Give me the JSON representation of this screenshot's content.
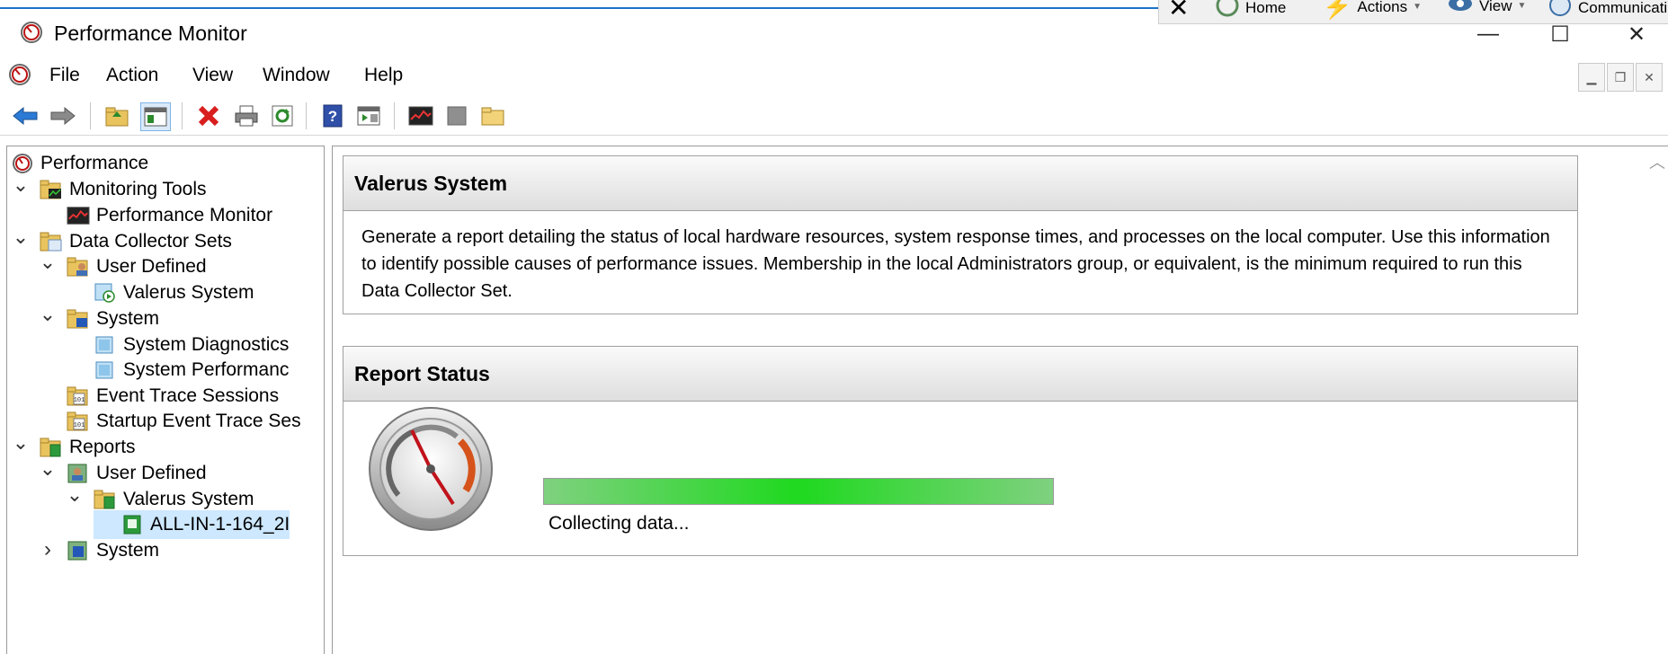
{
  "window": {
    "title": "Performance Monitor",
    "controls": {
      "minimize": "—",
      "maximize": "☐",
      "close": "✕"
    }
  },
  "overlay_bar": {
    "items": [
      {
        "label": "Home",
        "icon": "home-icon"
      },
      {
        "label": "Actions",
        "icon": "lightning-icon"
      },
      {
        "label": "View",
        "icon": "eye-icon"
      },
      {
        "label": "Communicati",
        "icon": "phone-icon"
      }
    ]
  },
  "menu": {
    "items": [
      "File",
      "Action",
      "View",
      "Window",
      "Help"
    ]
  },
  "toolbar": {
    "buttons": [
      "back",
      "forward",
      "up-folder",
      "show-hide-console-tree",
      "delete",
      "print",
      "refresh",
      "help",
      "show-action-pane",
      "performance-monitor",
      "stop",
      "new-folder"
    ]
  },
  "tree": {
    "items": [
      {
        "label": "Performance",
        "icon": "perfmon-icon",
        "level": 0,
        "expanded": null
      },
      {
        "label": "Monitoring Tools",
        "icon": "folder-chart-icon",
        "level": 0,
        "expanded": true
      },
      {
        "label": "Performance Monitor",
        "icon": "chart-monitor-icon",
        "level": 1,
        "expanded": null
      },
      {
        "label": "Data Collector Sets",
        "icon": "folder-sets-icon",
        "level": 0,
        "expanded": true
      },
      {
        "label": "User Defined",
        "icon": "folder-user-icon",
        "level": 1,
        "expanded": true
      },
      {
        "label": "Valerus System",
        "icon": "collector-set-running-icon",
        "level": 2,
        "expanded": null
      },
      {
        "label": "System",
        "icon": "folder-system-icon",
        "level": 1,
        "expanded": true
      },
      {
        "label": "System Diagnostics",
        "icon": "collector-set-icon",
        "level": 2,
        "expanded": null
      },
      {
        "label": "System Performanc",
        "icon": "collector-set-icon",
        "level": 2,
        "expanded": null
      },
      {
        "label": "Event Trace Sessions",
        "icon": "trace-icon",
        "level": 1,
        "expanded": null
      },
      {
        "label": "Startup Event Trace Ses",
        "icon": "trace-icon",
        "level": 1,
        "expanded": null
      },
      {
        "label": "Reports",
        "icon": "folder-reports-icon",
        "level": 0,
        "expanded": true
      },
      {
        "label": "User Defined",
        "icon": "folder-user-report-icon",
        "level": 1,
        "expanded": true
      },
      {
        "label": "Valerus System",
        "icon": "folder-report-icon",
        "level": 2,
        "expanded": true
      },
      {
        "label": "ALL-IN-1-164_2I",
        "icon": "report-icon",
        "level": 3,
        "expanded": null,
        "selected": true
      },
      {
        "label": "System",
        "icon": "folder-system-report-icon",
        "level": 1,
        "expanded": false
      }
    ]
  },
  "content": {
    "description_panel": {
      "title": "Valerus System",
      "text": "Generate a report detailing the status of local hardware resources, system response times, and processes on the local computer. Use this information to identify possible causes of performance issues. Membership in the local Administrators group, or equivalent, is the minimum required to run this Data Collector Set."
    },
    "status_panel": {
      "title": "Report Status",
      "progress_fraction": 1.0,
      "status_text": "Collecting data..."
    }
  },
  "colors": {
    "accent": "#1c73c8",
    "progress_green": "#1fd91f",
    "selection": "#cde8ff"
  }
}
